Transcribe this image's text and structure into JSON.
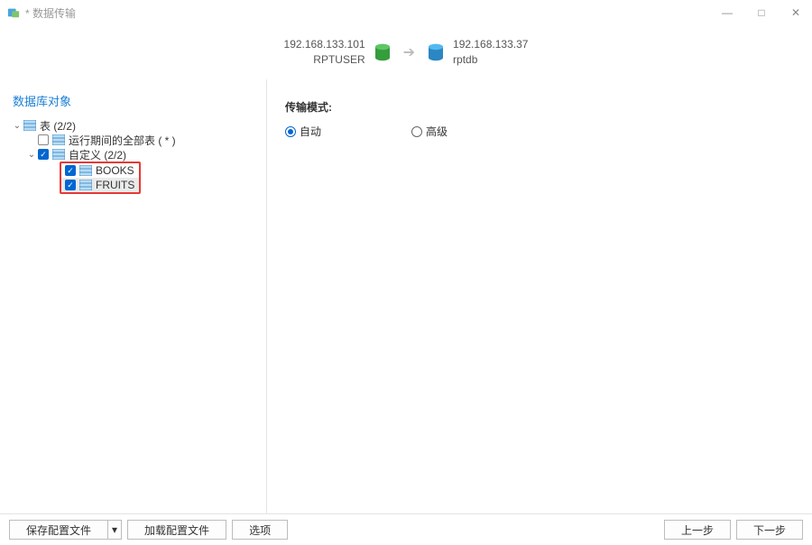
{
  "window": {
    "title": "* 数据传输"
  },
  "connection": {
    "source": {
      "host": "192.168.133.101",
      "user": "RPTUSER"
    },
    "target": {
      "host": "192.168.133.37",
      "db": "rptdb"
    }
  },
  "left": {
    "section_title": "数据库对象",
    "tree": {
      "tables_label": "表 (2/2)",
      "runtime_all_label": "运行期间的全部表 ( * )",
      "custom_label": "自定义 (2/2)",
      "items": [
        {
          "name": "BOOKS"
        },
        {
          "name": "FRUITS"
        }
      ]
    }
  },
  "right": {
    "mode_label": "传输模式:",
    "radio_auto": "自动",
    "radio_adv": "高级"
  },
  "footer": {
    "save_profile": "保存配置文件",
    "load_profile": "加载配置文件",
    "options": "选项",
    "prev": "上一步",
    "next": "下一步"
  }
}
